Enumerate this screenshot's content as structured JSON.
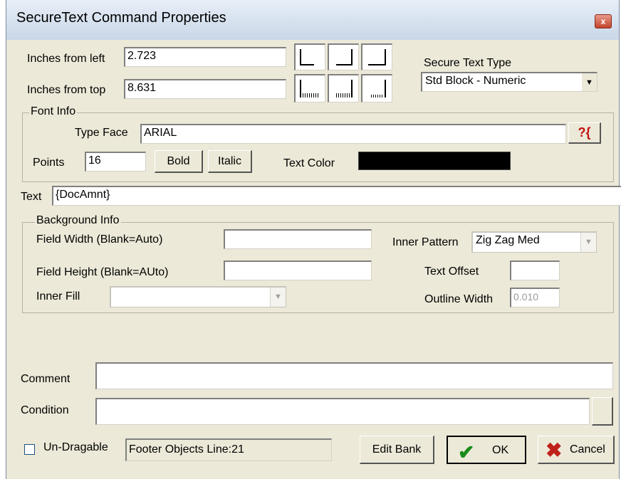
{
  "window": {
    "title": "SecureText Command Properties",
    "close_glyph": "x"
  },
  "position": {
    "left_label": "Inches from left",
    "left_value": "2.723",
    "top_label": "Inches from top",
    "top_value": "8.631"
  },
  "secure_text_type": {
    "label": "Secure Text Type",
    "value": "Std Block - Numeric"
  },
  "font_info": {
    "group_label": "Font Info",
    "type_face_label": "Type Face",
    "type_face_value": "ARIAL",
    "help_glyph": "?{",
    "points_label": "Points",
    "points_value": "16",
    "bold_label": "Bold",
    "italic_label": "Italic",
    "text_color_label": "Text Color",
    "text_color": "#000000"
  },
  "text": {
    "label": "Text",
    "value": "{DocAmnt}"
  },
  "background_info": {
    "group_label": "Background Info",
    "field_width_label": "Field Width (Blank=Auto)",
    "field_width_value": "",
    "field_height_label": "Field Height (Blank=AUto)",
    "field_height_value": "",
    "inner_fill_label": "Inner Fill",
    "inner_fill_value": "",
    "inner_pattern_label": "Inner Pattern",
    "inner_pattern_value": "Zig Zag Med",
    "text_offset_label": "Text Offset",
    "text_offset_value": "",
    "outline_width_label": "Outline Width",
    "outline_width_value": "0.010"
  },
  "comment": {
    "label": "Comment",
    "value": ""
  },
  "condition": {
    "label": "Condition",
    "value": ""
  },
  "footer": {
    "undraggable_label": "Un-Dragable",
    "undraggable_checked": false,
    "status_text": "Footer Objects  Line:21",
    "edit_bank_label": "Edit Bank",
    "ok_label": "OK",
    "cancel_label": "Cancel"
  },
  "icons": {
    "ok": "checkmark-icon",
    "cancel": "x-icon",
    "help": "help-icon"
  },
  "colors": {
    "dialog_bg": "#ece9d8",
    "ok_check": "#1a8c1a",
    "cancel_x": "#c0201a"
  }
}
